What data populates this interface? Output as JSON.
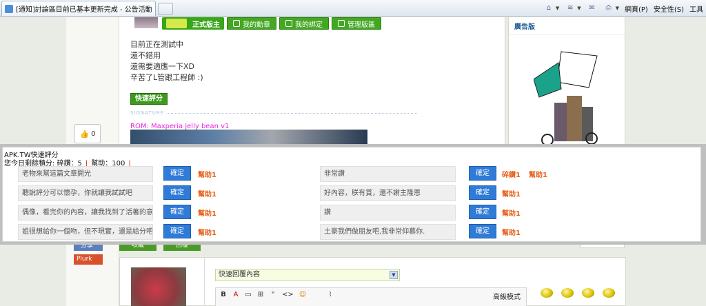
{
  "browser": {
    "tab_title": "[通知]討論區目前已基本更新完成 - 公告活動區 - ...",
    "menus": [
      "網頁(P)",
      "安全性(S)",
      "工具"
    ]
  },
  "post": {
    "badges": [
      "正式版主",
      "我的勳章",
      "我的綁定",
      "管理版區"
    ],
    "lines": [
      "目前正在測試中",
      "還不錯用",
      "還需要適應一下XD",
      "辛苦了L管跟工程師 :)"
    ],
    "rate_button": "快速評分",
    "signature_label": "SIGNATURE",
    "rom_text": "ROM: Maxperia jelly bean v1"
  },
  "sidebar": {
    "like_count": "0",
    "share1": "分享",
    "share2": "Plurk"
  },
  "bottom_tabs": [
    "收藏",
    "回覆"
  ],
  "ad": {
    "header": "廣告版"
  },
  "reply": {
    "select_value": "快速回覆內容",
    "advanced_mode": "高級模式",
    "tools": [
      "B",
      "A",
      "▭",
      "⊞",
      "\"",
      "<>",
      "☺"
    ]
  },
  "rating": {
    "title": "APK.TW快速評分",
    "quota_prefix": "您今日剩餘積分: 碎鑽：5",
    "quota_help": "幫助：100",
    "confirm_label": "確定",
    "rows_left": [
      {
        "reason": "老物來幫這篇文章開光",
        "rewards": [
          "幫助1"
        ]
      },
      {
        "reason": "聽說評分可以懷孕，你就讓我試試吧",
        "rewards": [
          "幫助1"
        ]
      },
      {
        "reason": "偶像，看完你的內容，讓我找到了活著的意義",
        "rewards": [
          "幫助1"
        ]
      },
      {
        "reason": "姐很想給你一個吻，但不現實，還是給分吧",
        "rewards": [
          "幫助1"
        ]
      }
    ],
    "rows_right": [
      {
        "reason": "非常讚",
        "rewards": [
          "碎鑽1",
          "幫助1"
        ]
      },
      {
        "reason": "好內容，朕有賞，還不謝主隆恩",
        "rewards": [
          "幫助1"
        ]
      },
      {
        "reason": "讚",
        "rewards": [
          "幫助1"
        ]
      },
      {
        "reason": "土豪我們做朋友吧,我非常仰慕你.",
        "rewards": [
          "幫助1"
        ]
      }
    ]
  }
}
